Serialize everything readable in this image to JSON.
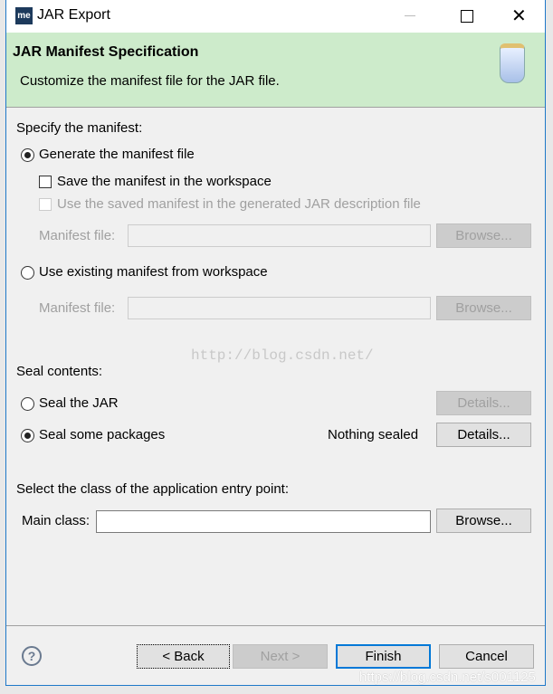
{
  "window": {
    "title": "JAR Export",
    "app_icon": "me"
  },
  "header": {
    "title": "JAR Manifest Specification",
    "description": "Customize the manifest file for the JAR file.",
    "icon": "jar-icon"
  },
  "manifest": {
    "section_label": "Specify the manifest:",
    "generate_label": "Generate the manifest file",
    "save_label": "Save the manifest in the workspace",
    "use_saved_label": "Use the saved manifest in the generated JAR description file",
    "manifest_file_label": "Manifest file:",
    "manifest_file_value": "",
    "browse_label": "Browse...",
    "use_existing_label": "Use existing manifest from workspace",
    "existing_file_label": "Manifest file:",
    "existing_file_value": "",
    "existing_browse_label": "Browse..."
  },
  "watermark": "http://blog.csdn.net/",
  "seal": {
    "section_label": "Seal contents:",
    "seal_jar_label": "Seal the JAR",
    "details_label": "Details...",
    "seal_some_label": "Seal some packages",
    "status": "Nothing sealed",
    "details2_label": "Details..."
  },
  "entry": {
    "section_label": "Select the class of the application entry point:",
    "main_class_label": "Main class:",
    "main_class_value": "",
    "browse_label": "Browse..."
  },
  "footer": {
    "back": "< Back",
    "next": "Next >",
    "finish": "Finish",
    "cancel": "Cancel",
    "watermark": "https://blog.csdn.net/s001125"
  }
}
